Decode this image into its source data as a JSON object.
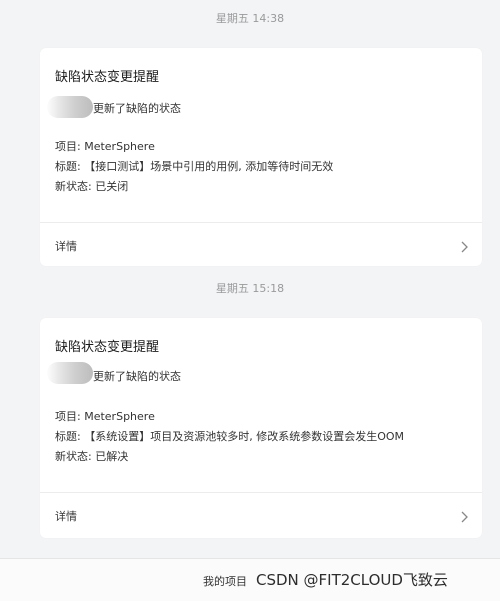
{
  "notifications": [
    {
      "time": "星期五 14:38",
      "title": "缺陷状态变更提醒",
      "actor_action": "更新了缺陷的状态",
      "project_label": "项目:",
      "project": "MeterSphere",
      "subject_label": "标题:",
      "subject": "【接口测试】场景中引用的用例, 添加等待时间无效",
      "status_label": "新状态:",
      "status": "已关闭",
      "details_label": "详情"
    },
    {
      "time": "星期五 15:18",
      "title": "缺陷状态变更提醒",
      "actor_action": "更新了缺陷的状态",
      "project_label": "项目:",
      "project": "MeterSphere",
      "subject_label": "标题:",
      "subject": "【系统设置】项目及资源池较多时, 修改系统参数设置会发生OOM",
      "status_label": "新状态:",
      "status": "已解决",
      "details_label": "详情"
    }
  ],
  "bottom_bar": {
    "menu_label": "我的项目",
    "watermark": "CSDN @FIT2CLOUD飞致云"
  }
}
